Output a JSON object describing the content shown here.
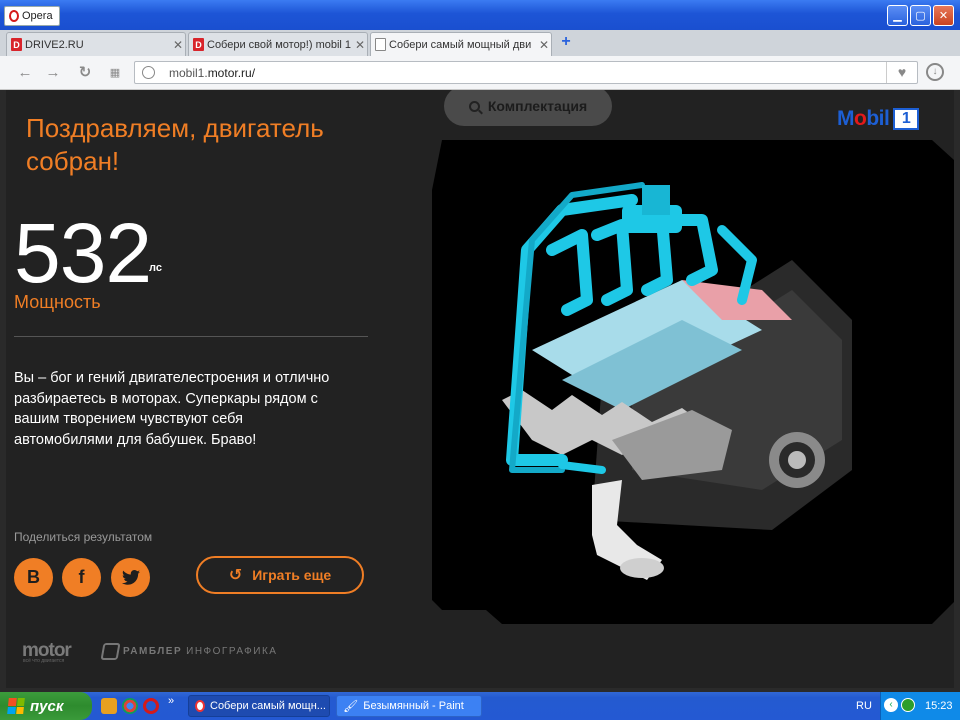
{
  "window": {
    "opera_button_label": "Opera",
    "controls": [
      "minimize",
      "maximize",
      "close"
    ]
  },
  "tabs": [
    {
      "label": "DRIVE2.RU",
      "active": false
    },
    {
      "label": "Собери свой мотор!) mobil 1",
      "active": false
    },
    {
      "label": "Собери самый мощный дви",
      "active": true
    }
  ],
  "address_bar": {
    "url_prefix": "mobil1.",
    "url_domain": "motor.ru/"
  },
  "page": {
    "congrats_title": "Поздравляем, двигатель собран!",
    "power_value": "532",
    "power_unit": "лс",
    "power_label": "Мощность",
    "description": "Вы – бог и гений двигателестроения и отлично разбираетесь в моторах. Суперкары рядом с вашим творением чувствуют себя автомобилями для бабушек. Браво!",
    "share_label": "Поделиться результатом",
    "social": [
      {
        "name": "vk",
        "glyph": "B"
      },
      {
        "name": "facebook",
        "glyph": "f"
      },
      {
        "name": "twitter",
        "glyph": "t"
      }
    ],
    "play_again_label": "Играть еще",
    "config_button_label": "Комплектация",
    "brand_logo": {
      "pre": "M",
      "o": "o",
      "post": "bil",
      "one": "1"
    },
    "footer_motor": "motor",
    "footer_motor_sub": "всё что двигается",
    "footer_rambler": "РАМБЛЕР",
    "footer_rambler_sub": "ИНФОГРАФИКА",
    "colors": {
      "accent": "#f07e25",
      "engine_pipes": "#1ec8e6",
      "background": "#222222"
    }
  },
  "taskbar": {
    "start_label": "пуск",
    "tasks": [
      {
        "label": "Собери самый мощн...",
        "active": true
      },
      {
        "label": "Безымянный - Paint",
        "active": false
      }
    ],
    "language": "RU",
    "clock": "15:23"
  }
}
